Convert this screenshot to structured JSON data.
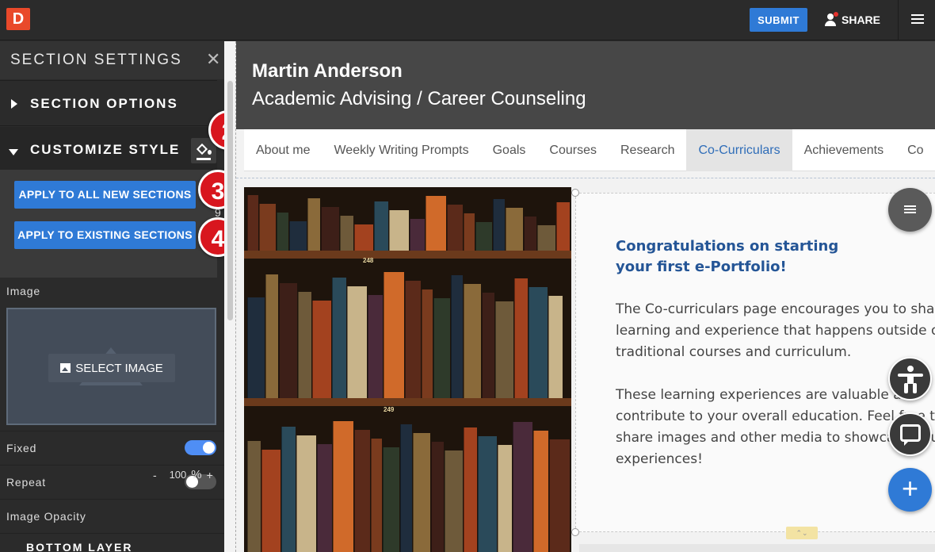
{
  "topbar": {
    "logo_letter": "D",
    "submit_label": "SUBMIT",
    "share_label": "SHARE"
  },
  "sidebar": {
    "title": "SECTION SETTINGS",
    "close_glyph": "✕",
    "section_options_label": "SECTION OPTIONS",
    "customize_style_label": "CUSTOMIZE STYLE",
    "apply_new_label": "APPLY TO ALL NEW SECTIONS",
    "apply_existing_label": "APPLY TO EXISTING SECTIONS",
    "stray_digit": "9",
    "image_label": "Image",
    "select_image_label": "SELECT IMAGE",
    "fixed_label": "Fixed",
    "fixed_on": true,
    "repeat_label": "Repeat",
    "repeat_on": false,
    "opacity_label": "Image Opacity",
    "opacity_minus": "-",
    "opacity_value": "100",
    "opacity_unit": "%",
    "opacity_plus": "+",
    "bottom_layer_label": "BOTTOM LAYER"
  },
  "callouts": [
    "2",
    "3",
    "4"
  ],
  "page": {
    "name": "Martin Anderson",
    "subtitle": "Academic Advising / Career Counseling",
    "nav": [
      {
        "label": "About me",
        "active": false
      },
      {
        "label": "Weekly Writing Prompts",
        "active": false
      },
      {
        "label": "Goals",
        "active": false
      },
      {
        "label": "Courses",
        "active": false
      },
      {
        "label": "Research",
        "active": false
      },
      {
        "label": "Co-Curriculars",
        "active": true
      },
      {
        "label": "Achievements",
        "active": false
      },
      {
        "label": "Co",
        "active": false
      }
    ],
    "shelf_labels": [
      "248",
      "249"
    ],
    "heading": "Congratulations on starting your first e-Portfolio!",
    "paragraph1": "The Co-curriculars page encourages you to share learning and experience that happens outside of traditional courses and curriculum.",
    "paragraph2": "These learning experiences are valuable and contribute to your overall education. Feel free to share images and other media to showcase your experiences!",
    "add_glyph": "+",
    "drag_glyph": "⌃⌄"
  },
  "colors": {
    "accent_blue": "#2f7ad6",
    "callout_red": "#d8161e",
    "heading_blue": "#245596",
    "logo_orange": "#e9492a"
  }
}
